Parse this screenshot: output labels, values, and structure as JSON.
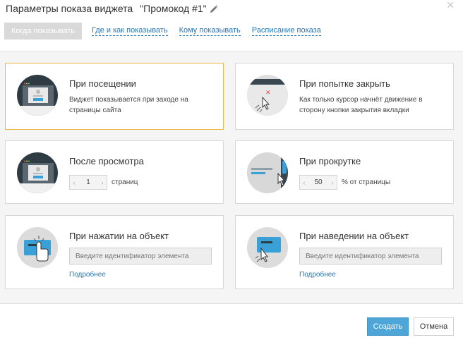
{
  "header": {
    "title": "Параметры показа виджета",
    "promo_name": "\"Промокод #1\""
  },
  "tabs": [
    {
      "label": "Когда показывать"
    },
    {
      "label": "Где и как показывать"
    },
    {
      "label": "Кому показывать"
    },
    {
      "label": "Расписание показа"
    }
  ],
  "cards": {
    "visit": {
      "title": "При посещении",
      "desc": "Виджет показывается при заходе на страницы сайта"
    },
    "close": {
      "title": "При попытке закрыть",
      "desc": "Как только курсор начнёт движение в сторону кнопки закрытия вкладки"
    },
    "views": {
      "title": "После просмотра",
      "value": "1",
      "unit": "страниц"
    },
    "scroll": {
      "title": "При прокрутке",
      "value": "50",
      "unit": "% от страницы"
    },
    "click": {
      "title": "При нажатии на объект",
      "placeholder": "Введите идентификатор элемента",
      "more": "Подробнее"
    },
    "hover": {
      "title": "При наведении на объект",
      "placeholder": "Введите идентификатор элемента",
      "more": "Подробнее"
    }
  },
  "footer": {
    "create": "Создать",
    "cancel": "Отмена"
  }
}
